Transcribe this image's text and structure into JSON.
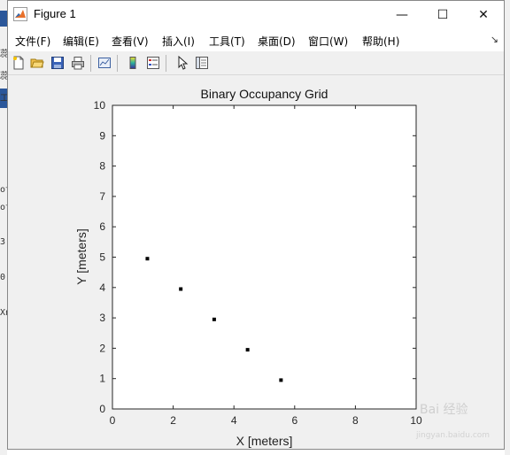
{
  "window": {
    "title": "Figure 1",
    "minimize_glyph": "—",
    "maximize_glyph": "☐",
    "close_glyph": "✕"
  },
  "menu": [
    {
      "label": "文件(F)"
    },
    {
      "label": "编辑(E)"
    },
    {
      "label": "查看(V)"
    },
    {
      "label": "插入(I)"
    },
    {
      "label": "工具(T)"
    },
    {
      "label": "桌面(D)"
    },
    {
      "label": "窗口(W)"
    },
    {
      "label": "帮助(H)"
    }
  ],
  "menu_dock_glyph": "↘",
  "toolbar": {
    "icons": [
      "new-figure-icon",
      "open-file-icon",
      "save-icon",
      "print-icon",
      "link-plot-icon",
      "colorbar-icon",
      "legend-icon",
      "edit-plot-arrow-icon",
      "property-inspector-icon"
    ]
  },
  "background_text": [
    "蕊",
    "蕊",
    "工",
    "ot",
    "ot",
    "3",
    "0",
    "Xn"
  ],
  "watermark": {
    "text": "Bai 经验",
    "url": "jingyan.baidu.com"
  },
  "colors": {
    "titlebar": "#ffffff",
    "figure_bg": "#f0f0f0",
    "axes_bg": "#ffffff",
    "marker": "#000000"
  },
  "chart_data": {
    "type": "scatter",
    "title": "Binary Occupancy Grid",
    "xlabel": "X [meters]",
    "ylabel": "Y [meters]",
    "xlim": [
      0,
      10
    ],
    "ylim": [
      0,
      10
    ],
    "xticks": [
      0,
      2,
      4,
      6,
      8,
      10
    ],
    "yticks": [
      0,
      1,
      2,
      3,
      4,
      5,
      6,
      7,
      8,
      9,
      10
    ],
    "grid": false,
    "points": [
      {
        "x": 1.15,
        "y": 4.95
      },
      {
        "x": 2.25,
        "y": 3.95
      },
      {
        "x": 3.35,
        "y": 2.95
      },
      {
        "x": 4.45,
        "y": 1.95
      },
      {
        "x": 5.55,
        "y": 0.95
      }
    ]
  }
}
